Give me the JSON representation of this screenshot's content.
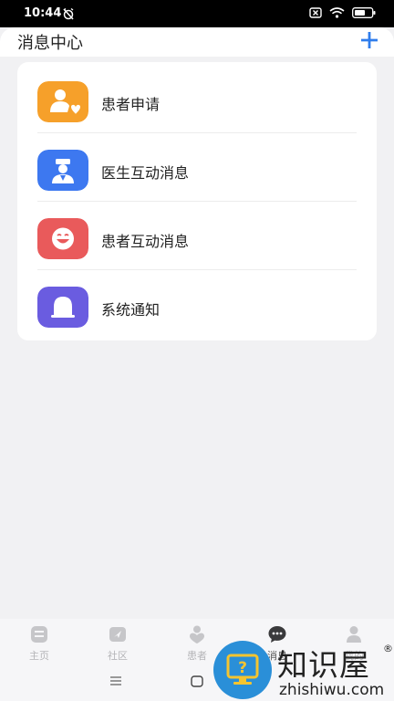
{
  "status_bar": {
    "time": "10:44",
    "icons": [
      "alarm-off-icon",
      "sim-x-icon",
      "wifi-icon",
      "battery-icon"
    ]
  },
  "header": {
    "title": "消息中心",
    "add_icon": "plus-icon"
  },
  "colors": {
    "accent": "#2f7dec",
    "apply": "#f6a02a",
    "doctor": "#3d78f0",
    "patient": "#e95a5b",
    "system": "#6a5ce0"
  },
  "messages": [
    {
      "label": "患者申请",
      "icon": "patient-apply-icon"
    },
    {
      "label": "医生互动消息",
      "icon": "doctor-icon"
    },
    {
      "label": "患者互动消息",
      "icon": "smile-face-icon"
    },
    {
      "label": "系统通知",
      "icon": "bell-icon"
    }
  ],
  "tabs": [
    {
      "label": "主页",
      "icon": "home-icon"
    },
    {
      "label": "社区",
      "icon": "community-icon"
    },
    {
      "label": "患者",
      "icon": "patient-heart-icon"
    },
    {
      "label": "消息",
      "icon": "chat-icon",
      "active": true
    },
    {
      "label": "我的",
      "icon": "profile-icon"
    }
  ],
  "nav": [
    "menu-icon",
    "home-square-icon",
    "back-icon"
  ],
  "watermark": {
    "title": "知识屋",
    "reg": "®",
    "url": "zhishiwu.com"
  }
}
